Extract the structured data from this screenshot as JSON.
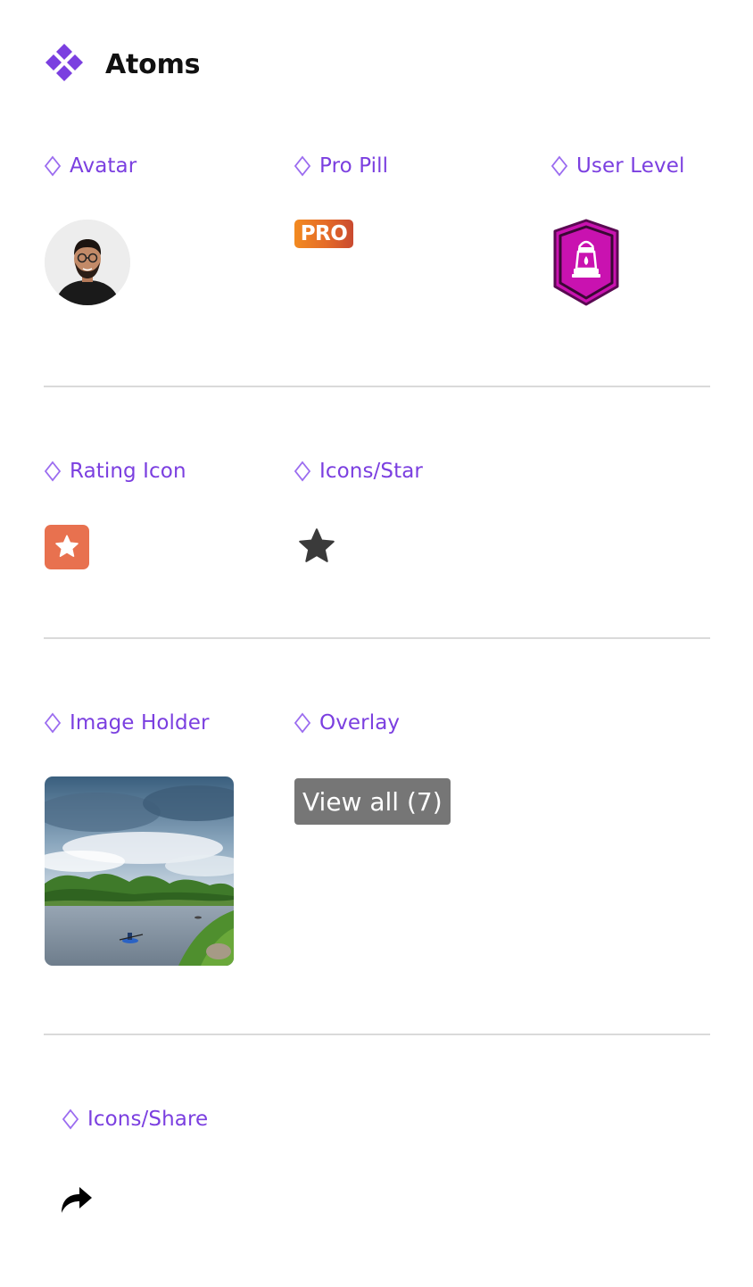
{
  "header": {
    "title": "Atoms",
    "logo_icon": "components-diamond-icon",
    "accent_color": "#7b3fe0"
  },
  "sections": {
    "avatar": {
      "label": "Avatar",
      "icon": "user-avatar-photo"
    },
    "pro_pill": {
      "label": "Pro Pill",
      "text": "PRO",
      "color": "#e46a28"
    },
    "user_level": {
      "label": "User Level",
      "icon": "lantern-badge-icon",
      "color": "#c912b0"
    },
    "rating_icon": {
      "label": "Rating Icon",
      "icon": "star-icon",
      "color": "#e8714f"
    },
    "icons_star": {
      "label": "Icons/Star",
      "icon": "star-icon",
      "color": "#3a3a3a"
    },
    "image_holder": {
      "label": "Image Holder",
      "image": "river-landscape-with-kayaker"
    },
    "overlay": {
      "label": "Overlay",
      "text": "View all (7)"
    },
    "icons_share": {
      "label": "Icons/Share",
      "icon": "share-arrow-icon"
    }
  }
}
